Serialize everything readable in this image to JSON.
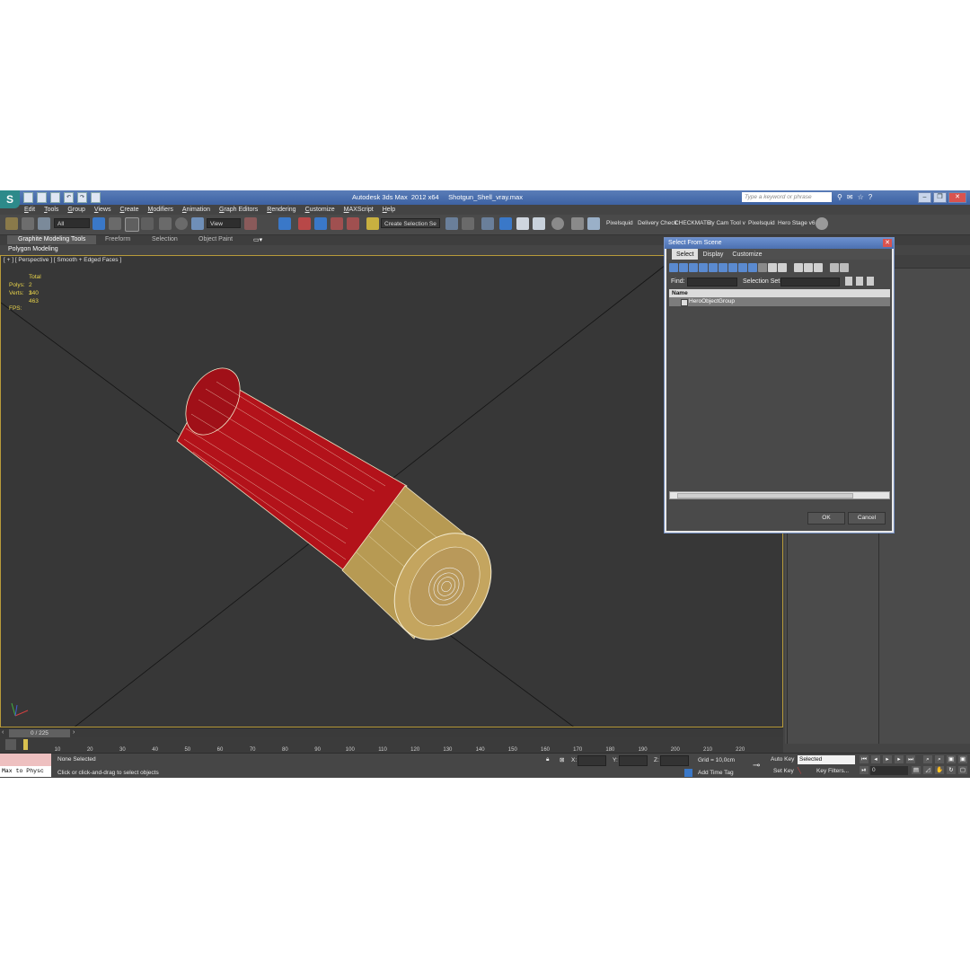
{
  "window": {
    "title": "Autodesk 3ds Max  2012 x64     Shotgun_Shell_vray.max",
    "search_placeholder": "Type a keyword or phrase"
  },
  "menu": [
    "Edit",
    "Tools",
    "Group",
    "Views",
    "Create",
    "Modifiers",
    "Animation",
    "Graph Editors",
    "Rendering",
    "Customize",
    "MAXScript",
    "Help"
  ],
  "toolbar": {
    "filter_value": "All",
    "refcoord_value": "View",
    "selection_set_value": "Create Selection Se",
    "custom_labels": [
      "Pixelsquid",
      "Delivery Check",
      "CHECKMATE",
      "uty Cam Tool v",
      "Pixelsquid",
      "Hero Stage v6"
    ]
  },
  "ribbon": {
    "tabs": [
      "Graphite Modeling Tools",
      "Freeform",
      "Selection",
      "Object Paint"
    ],
    "panel": "Polygon Modeling"
  },
  "viewport": {
    "label": "[ + ] [ Perspective ] [ Smooth + Edged Faces ]",
    "stats_header": "Total",
    "polys_label": "Polys:",
    "polys_value": "2 340",
    "verts_label": "Verts:",
    "verts_value": "1 463",
    "fps_label": "FPS:"
  },
  "dialog": {
    "title": "Select From Scene",
    "menu": [
      "Select",
      "Display",
      "Customize"
    ],
    "find_label": "Find:",
    "selection_set_label": "Selection Set:",
    "column_header": "Name",
    "items": [
      "HeroObjectGroup"
    ],
    "ok_label": "OK",
    "cancel_label": "Cancel"
  },
  "timeline": {
    "slider_text": "0 / 225",
    "ticks": [
      "10",
      "20",
      "30",
      "40",
      "50",
      "60",
      "70",
      "80",
      "90",
      "100",
      "110",
      "120",
      "130",
      "140",
      "150",
      "160",
      "170",
      "180",
      "190",
      "200",
      "210",
      "220"
    ]
  },
  "status": {
    "maxscript": "Max to Physc",
    "selection": "None Selected",
    "prompt": "Click or click-and-drag to select objects",
    "x_label": "X:",
    "y_label": "Y:",
    "z_label": "Z:",
    "grid": "Grid = 10,0cm",
    "add_time_tag": "Add Time Tag",
    "auto_key": "Auto Key",
    "set_key": "Set Key",
    "selected_value": "Selected",
    "key_filters": "Key Filters...",
    "frame_value": "0"
  },
  "colors": {
    "shell_red": "#b3121a",
    "brass": "#b79a53",
    "viewport_bg": "#373737",
    "title_blue": "#4c70b0"
  }
}
